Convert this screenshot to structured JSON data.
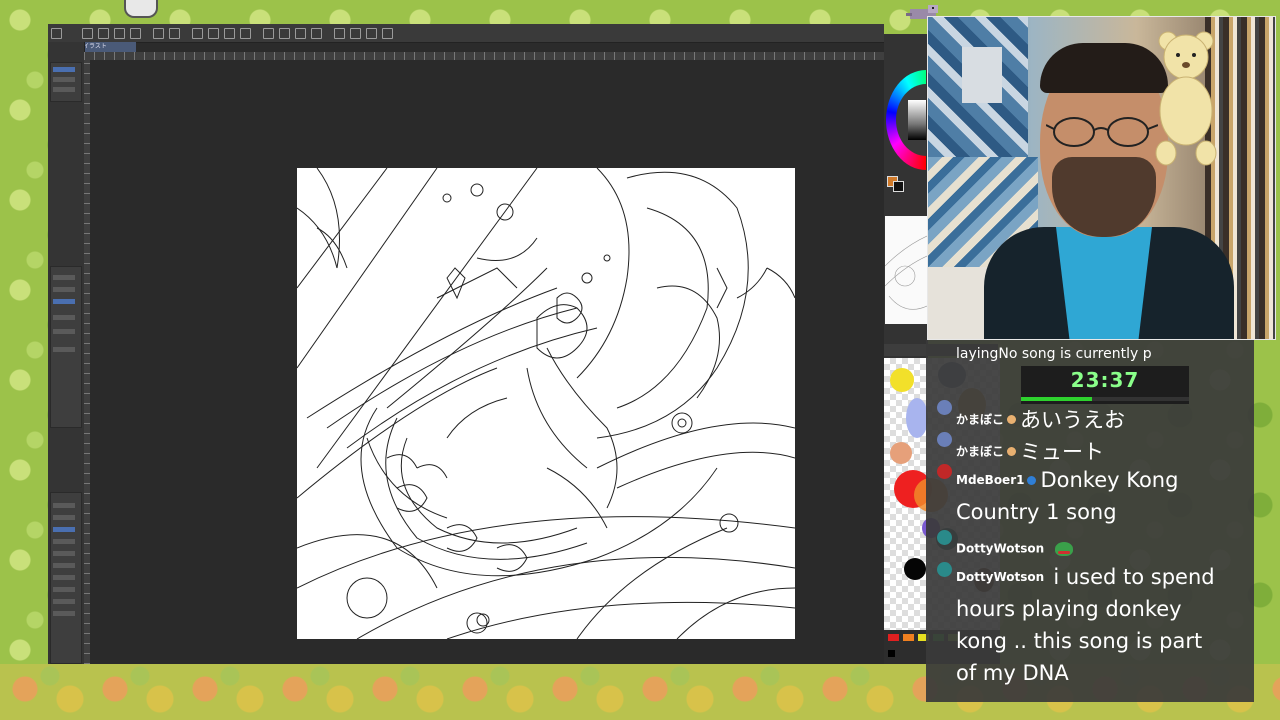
{
  "app": {
    "doc_tab": "イラスト"
  },
  "overlay": {
    "now_playing": "layingNo song is currently p",
    "timer": "23:37",
    "timer_progress": 0.42
  },
  "chat": [
    {
      "user": "かまぼこ",
      "badge_color": "#e8b070",
      "text": "あいうえお"
    },
    {
      "user": "かまぼこ",
      "badge_color": "#e8b070",
      "text": "ミュート"
    },
    {
      "user": "MdeBoer1",
      "badge_color": "#2f7fd6",
      "text": "Donkey Kong",
      "text2": "Country 1 song"
    },
    {
      "user": "DottyWotson",
      "emote": "frog-emote",
      "text": ""
    },
    {
      "user": "DottyWotson",
      "text": "i used to spend",
      "text2": "hours playing donkey",
      "text3": "kong .. this song is part",
      "text4": "of my DNA"
    }
  ],
  "colors": {
    "timer_green": "#8aff8a",
    "chat_bg": "#3a3a3a",
    "canvas_bg": "#2a2a2a"
  }
}
